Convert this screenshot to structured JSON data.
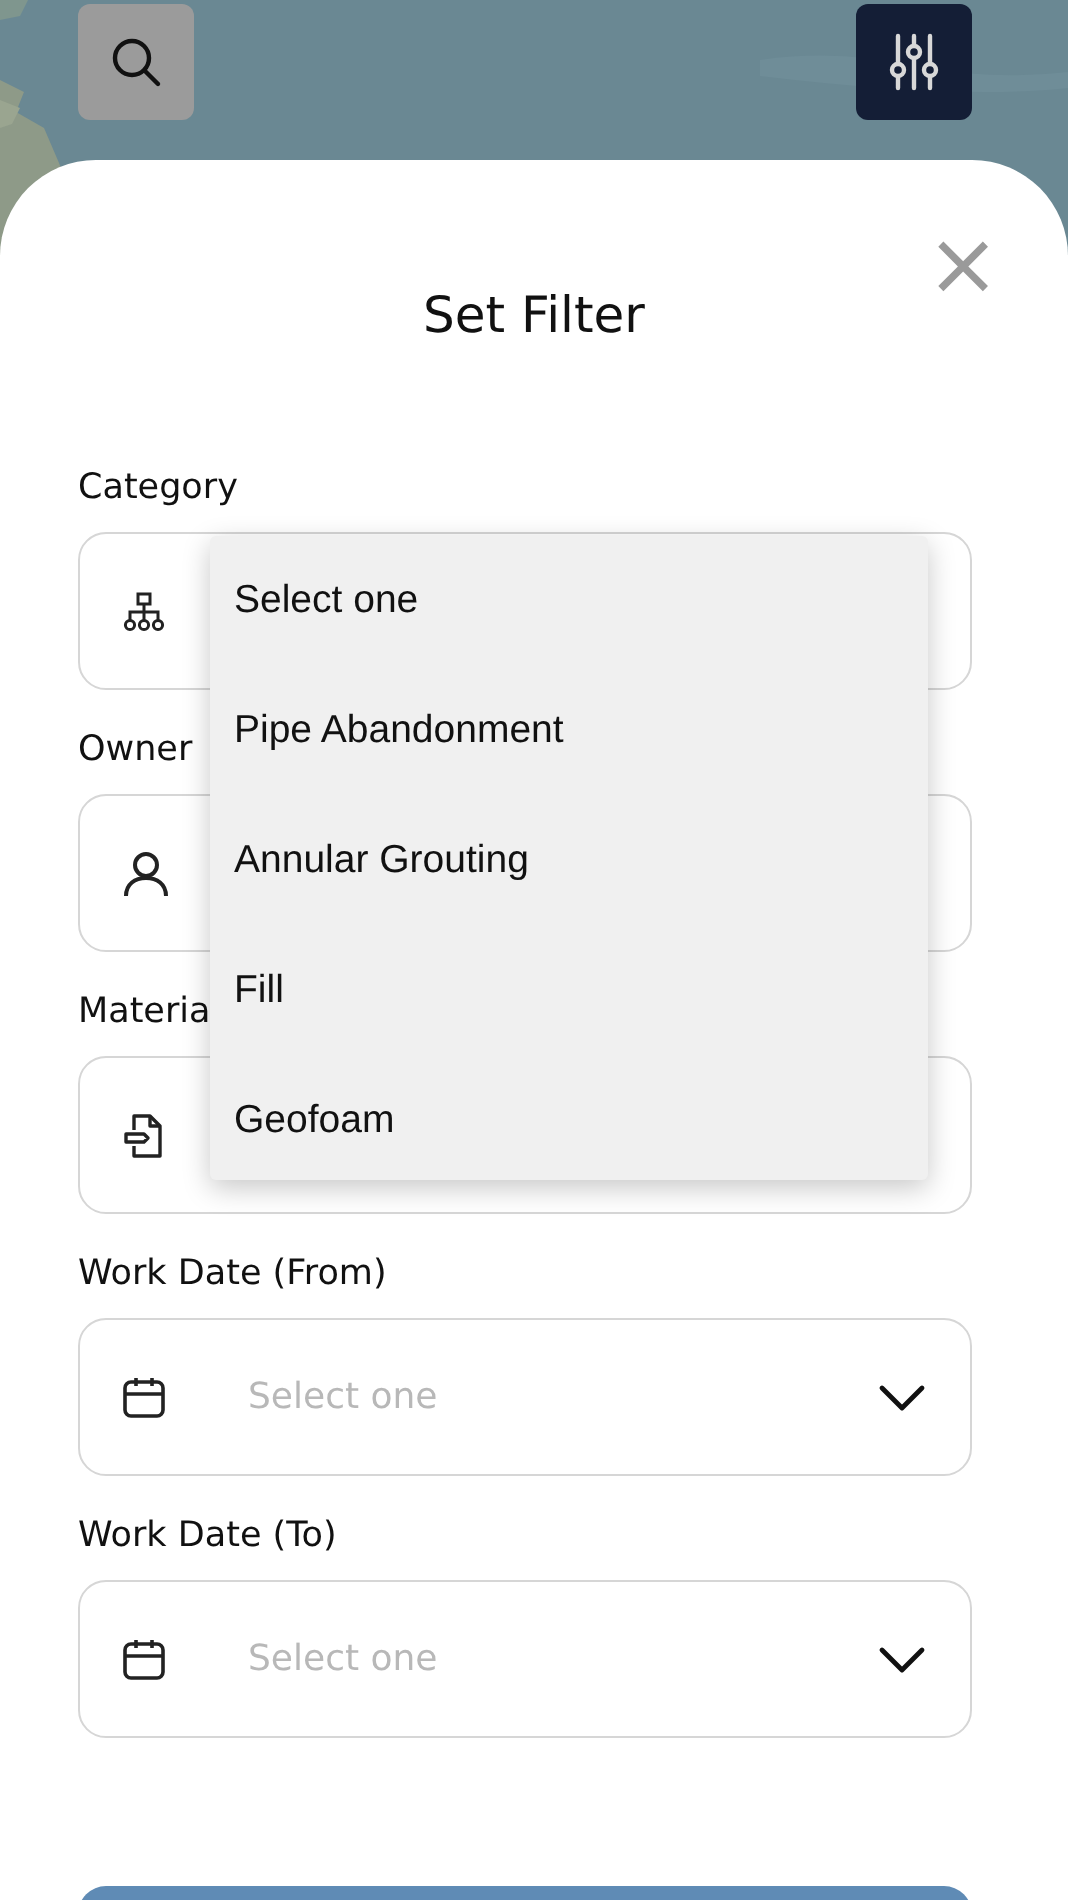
{
  "top_bar": {
    "search_button": {
      "kind": "search",
      "selected": false
    },
    "filter_button": {
      "kind": "filter",
      "selected": true
    }
  },
  "sheet": {
    "close": "×",
    "title": "Set Filter",
    "fields": [
      {
        "label": "Category",
        "kind": "select"
      },
      {
        "label": "Owner",
        "kind": "select"
      },
      {
        "label": "Materia",
        "kind": "select"
      },
      {
        "label": "Work Date (From)",
        "kind": "date",
        "placeholder": "Select one"
      },
      {
        "label": "Work Date (To)",
        "kind": "date",
        "placeholder": "Select one"
      }
    ],
    "dropdown": {
      "items": [
        {
          "label": "Select one",
          "selected": false
        },
        {
          "label": "Pipe Abandonment",
          "selected": false
        },
        {
          "label": "Annular Grouting",
          "selected": false
        },
        {
          "label": "Fill",
          "selected": false
        },
        {
          "label": "Geofoam",
          "selected": false
        }
      ]
    },
    "apply_button": {
      "kind": "primary"
    }
  }
}
